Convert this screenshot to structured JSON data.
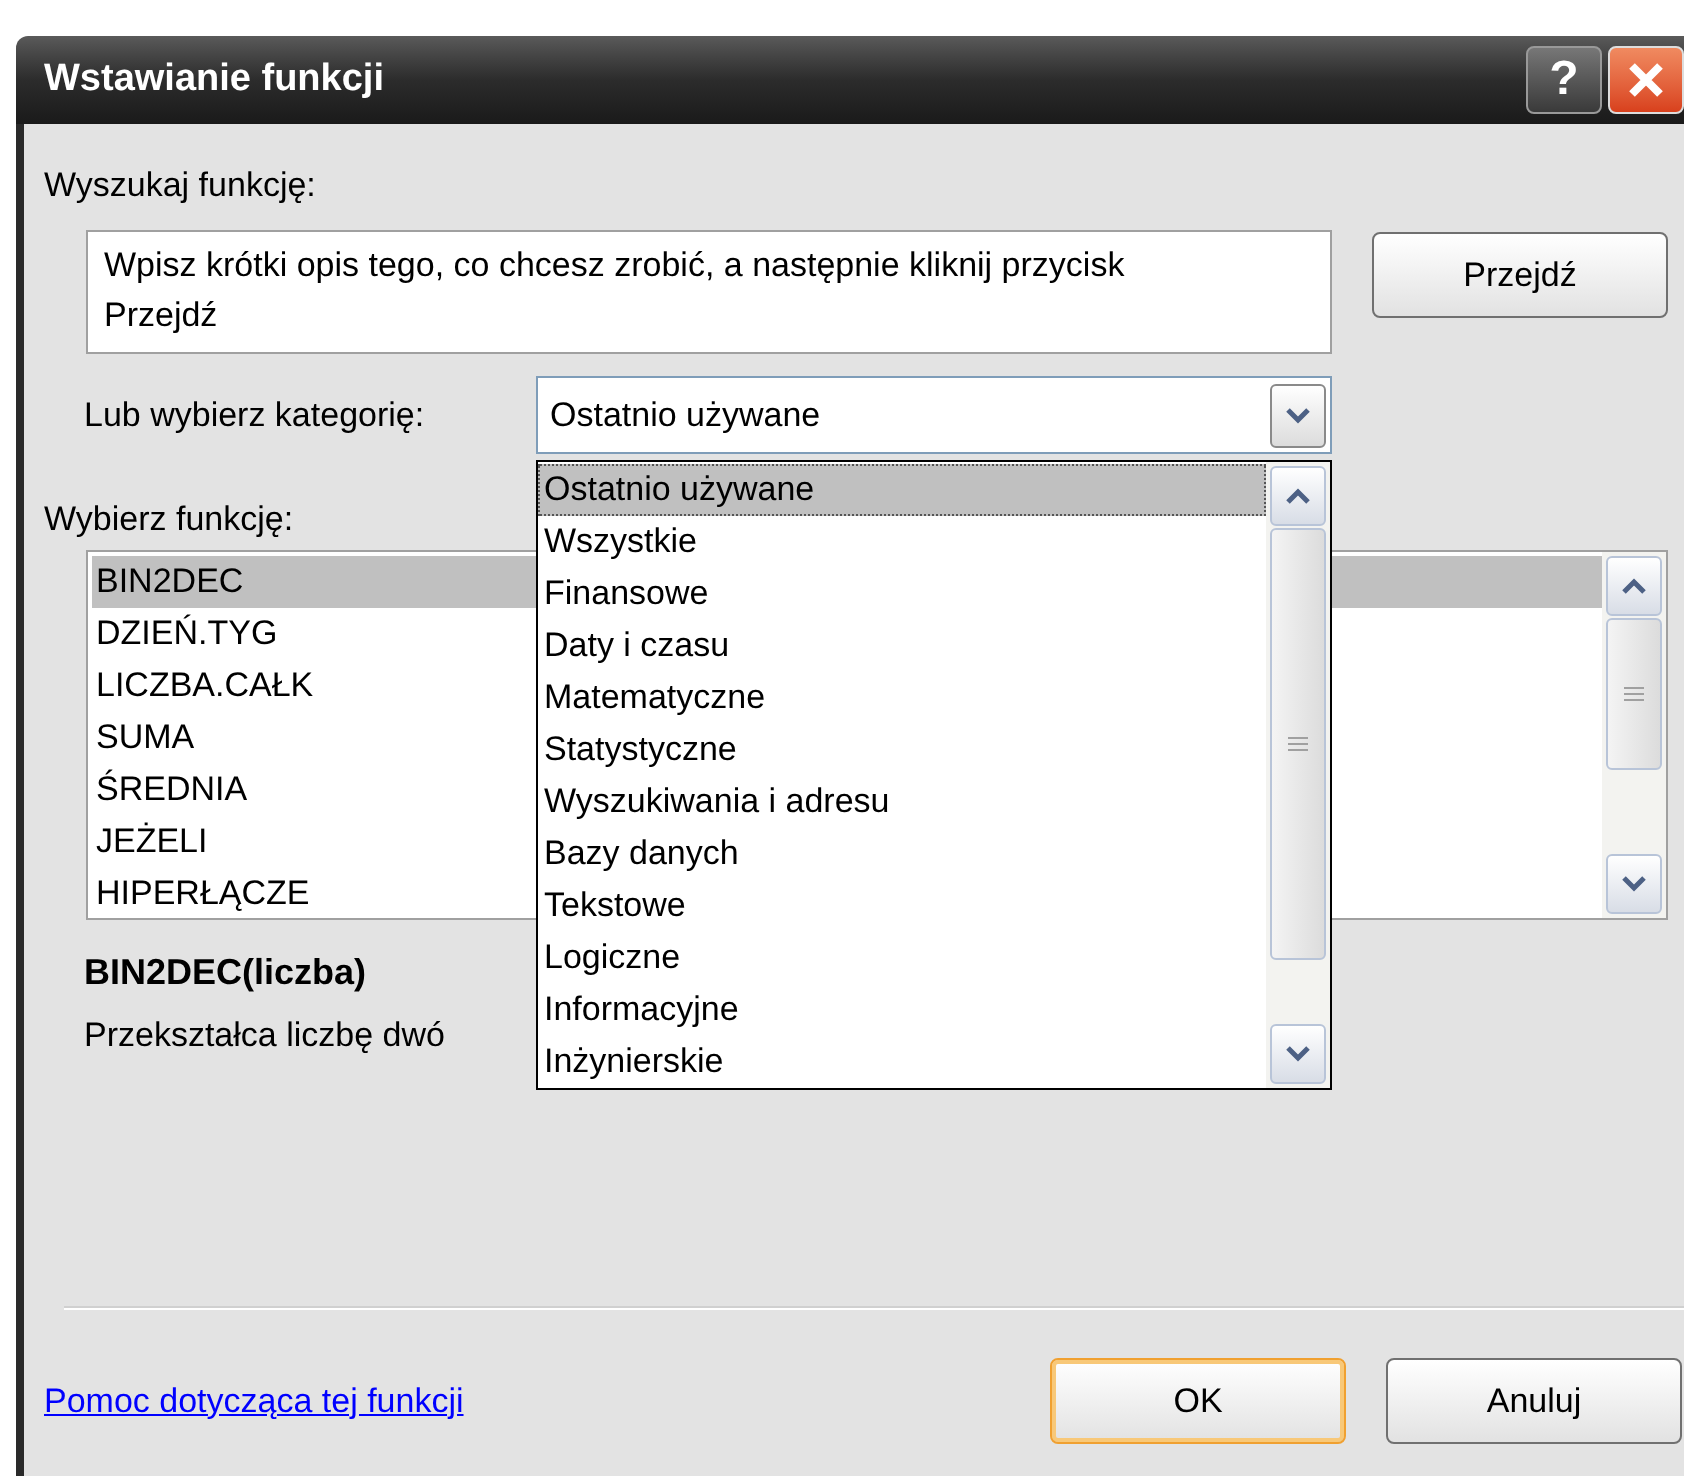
{
  "window": {
    "title": "Wstawianie funkcji",
    "help_label": "?"
  },
  "search": {
    "label": "Wyszukaj funkcję:",
    "value": "Wpisz krótki opis tego, co chcesz zrobić, a następnie kliknij przycisk Przejdź",
    "button": "Przejdź"
  },
  "category": {
    "label": "Lub wybierz kategorię:",
    "value": "Ostatnio używane",
    "expanded": true,
    "options": [
      {
        "label": "Ostatnio używane",
        "selected": true
      },
      {
        "label": "Wszystkie",
        "selected": false
      },
      {
        "label": "Finansowe",
        "selected": false
      },
      {
        "label": "Daty i czasu",
        "selected": false
      },
      {
        "label": "Matematyczne",
        "selected": false
      },
      {
        "label": "Statystyczne",
        "selected": false
      },
      {
        "label": "Wyszukiwania i adresu",
        "selected": false
      },
      {
        "label": "Bazy danych",
        "selected": false
      },
      {
        "label": "Tekstowe",
        "selected": false
      },
      {
        "label": "Logiczne",
        "selected": false
      },
      {
        "label": "Informacyjne",
        "selected": false
      },
      {
        "label": "Inżynierskie",
        "selected": false
      }
    ]
  },
  "functions": {
    "label": "Wybierz funkcję:",
    "items": [
      {
        "label": "BIN2DEC",
        "selected": true
      },
      {
        "label": "DZIEŃ.TYG",
        "selected": false
      },
      {
        "label": "LICZBA.CAŁK",
        "selected": false
      },
      {
        "label": "SUMA",
        "selected": false
      },
      {
        "label": "ŚREDNIA",
        "selected": false
      },
      {
        "label": "JEŻELI",
        "selected": false
      },
      {
        "label": "HIPERŁĄCZE",
        "selected": false
      }
    ]
  },
  "signature": "BIN2DEC(liczba)",
  "description": "Przekształca liczbę dwó",
  "help_link": "Pomoc dotycząca tej funkcji",
  "buttons": [
    {
      "label": "OK",
      "default": true
    },
    {
      "label": "Anuluj",
      "default": false
    }
  ]
}
